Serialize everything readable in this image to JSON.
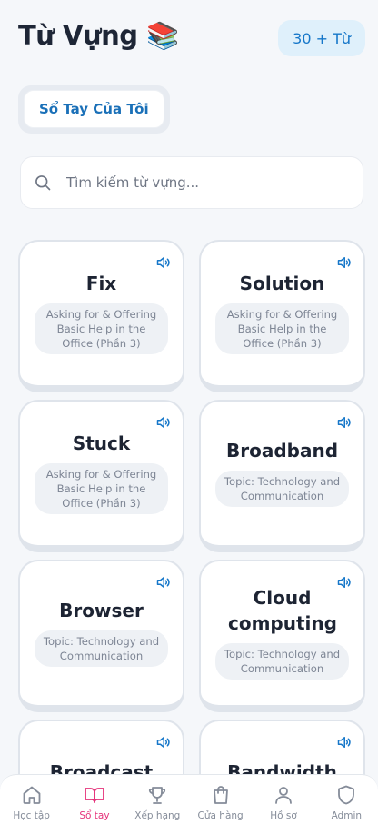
{
  "header": {
    "title": "Từ Vựng",
    "title_emoji": "📚",
    "count_badge": "30 + Từ"
  },
  "notebook_button": "Sổ Tay Của Tôi",
  "search": {
    "placeholder": "Tìm kiếm từ vựng..."
  },
  "cards": [
    {
      "word": "Fix",
      "topic": "Asking for & Offering Basic Help in the Office (Phần 3)"
    },
    {
      "word": "Solution",
      "topic": "Asking for & Offering Basic Help in the Office (Phần 3)"
    },
    {
      "word": "Stuck",
      "topic": "Asking for & Offering Basic Help in the Office (Phần 3)"
    },
    {
      "word": "Broadband",
      "topic": "Topic: Technology and Communication"
    },
    {
      "word": "Browser",
      "topic": "Topic: Technology and Communication"
    },
    {
      "word": "Cloud computing",
      "topic": "Topic: Technology and Communication"
    },
    {
      "word": "Broadcast",
      "topic": ""
    },
    {
      "word": "Bandwidth",
      "topic": ""
    }
  ],
  "nav": [
    {
      "label": "Học tập",
      "icon": "home-icon",
      "active": false
    },
    {
      "label": "Sổ tay",
      "icon": "book-icon",
      "active": true
    },
    {
      "label": "Xếp hạng",
      "icon": "trophy-icon",
      "active": false
    },
    {
      "label": "Cửa hàng",
      "icon": "shopping-bag-icon",
      "active": false
    },
    {
      "label": "Hồ sơ",
      "icon": "user-icon",
      "active": false
    },
    {
      "label": "Admin",
      "icon": "shield-icon",
      "active": false
    }
  ],
  "colors": {
    "accent": "#1a70b8",
    "active_nav": "#e5327a",
    "speaker": "#1677c9"
  }
}
